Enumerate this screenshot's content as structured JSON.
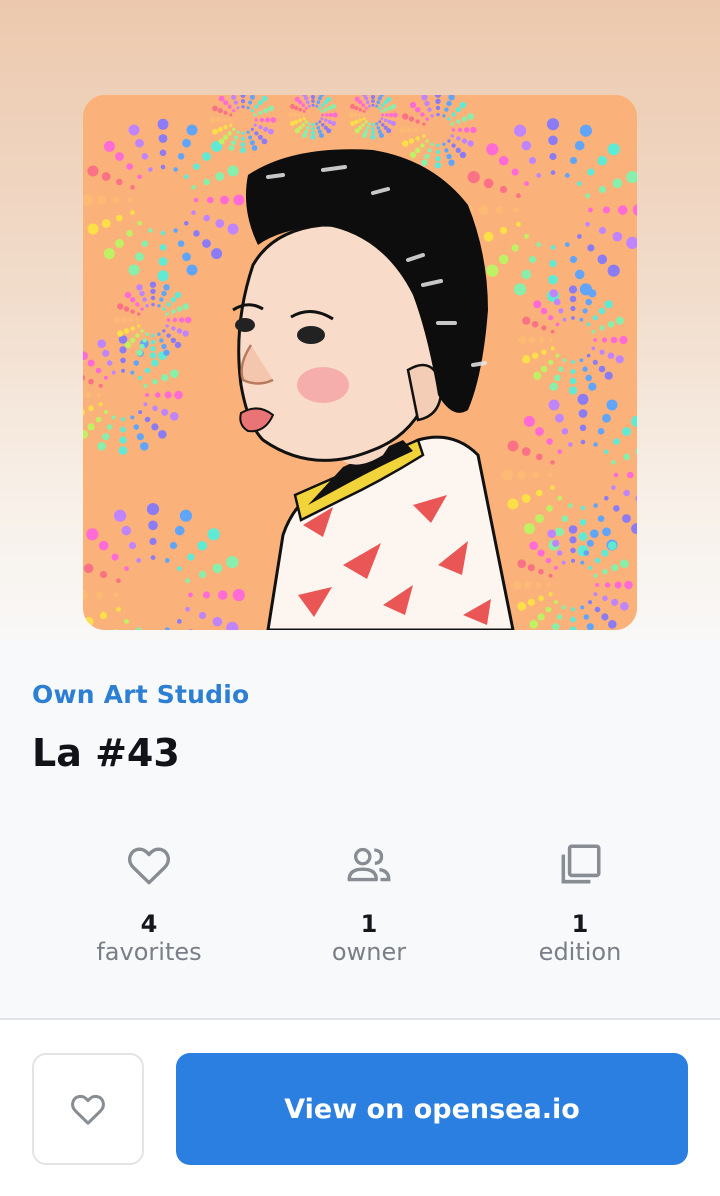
{
  "nft": {
    "collection": "Own Art Studio",
    "title": "La #43",
    "image_alt": "Illustrated portrait of a child in a red-patterned kimono surrounded by rainbow dot fireworks"
  },
  "stats": [
    {
      "icon": "heart-outline-icon",
      "value": "4",
      "label": "favorites"
    },
    {
      "icon": "people-icon",
      "value": "1",
      "label": "owner"
    },
    {
      "icon": "copies-icon",
      "value": "1",
      "label": "edition"
    }
  ],
  "actions": {
    "favorite_icon": "heart-outline-icon",
    "open_label": "View on opensea.io"
  },
  "colors": {
    "accent": "#2a7fe0",
    "collection_text": "#2d7fd3",
    "art_background": "#fbb27a"
  }
}
